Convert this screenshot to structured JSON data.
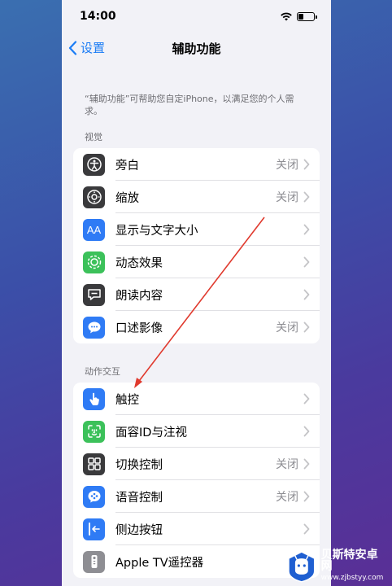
{
  "status_bar": {
    "time": "14:00"
  },
  "nav": {
    "back_label": "设置",
    "title": "辅助功能"
  },
  "intro_text": "“辅助功能”可帮助您自定iPhone，以满足您的个人需求。",
  "sections": [
    {
      "header": "视觉",
      "items": [
        {
          "label": "旁白",
          "value": "关闭",
          "icon": "voiceover-icon",
          "color": "#3a3a3c"
        },
        {
          "label": "缩放",
          "value": "关闭",
          "icon": "zoom-icon",
          "color": "#3a3a3c"
        },
        {
          "label": "显示与文字大小",
          "value": "",
          "icon": "text-size-icon",
          "color": "#2f7bf5"
        },
        {
          "label": "动态效果",
          "value": "",
          "icon": "motion-icon",
          "color": "#3cc15a"
        },
        {
          "label": "朗读内容",
          "value": "",
          "icon": "spoken-content-icon",
          "color": "#3a3a3c"
        },
        {
          "label": "口述影像",
          "value": "关闭",
          "icon": "audio-description-icon",
          "color": "#2f7bf5"
        }
      ]
    },
    {
      "header": "动作交互",
      "items": [
        {
          "label": "触控",
          "value": "",
          "icon": "touch-icon",
          "color": "#2f7bf5"
        },
        {
          "label": "面容ID与注视",
          "value": "",
          "icon": "face-id-icon",
          "color": "#3cc15a"
        },
        {
          "label": "切换控制",
          "value": "关闭",
          "icon": "switch-control-icon",
          "color": "#3a3a3c"
        },
        {
          "label": "语音控制",
          "value": "关闭",
          "icon": "voice-control-icon",
          "color": "#2f7bf5"
        },
        {
          "label": "侧边按钮",
          "value": "",
          "icon": "side-button-icon",
          "color": "#2f7bf5"
        },
        {
          "label": "Apple TV遥控器",
          "value": "",
          "icon": "apple-tv-remote-icon",
          "color": "#8e8e93"
        }
      ]
    }
  ],
  "watermark": {
    "title": "贝斯特安卓网",
    "url": "www.zjbstyy.com"
  },
  "colors": {
    "accent": "#1a7cf5",
    "annotation_arrow": "#e03a2e"
  }
}
